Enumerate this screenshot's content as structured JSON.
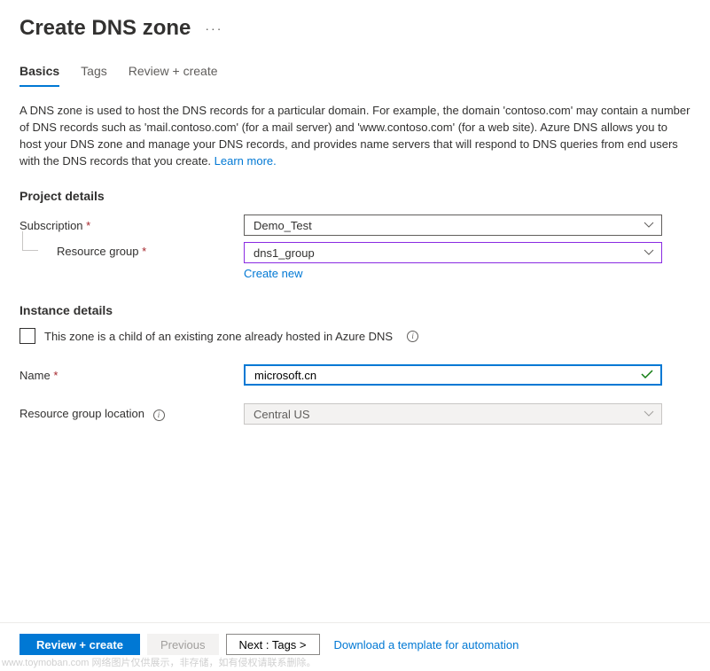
{
  "header": {
    "title": "Create DNS zone",
    "more": "···"
  },
  "tabs": {
    "basics": "Basics",
    "tags": "Tags",
    "review": "Review + create"
  },
  "description": {
    "text": "A DNS zone is used to host the DNS records for a particular domain. For example, the domain 'contoso.com' may contain a number of DNS records such as 'mail.contoso.com' (for a mail server) and 'www.contoso.com' (for a web site). Azure DNS allows you to host your DNS zone and manage your DNS records, and provides name servers that will respond to DNS queries from end users with the DNS records that you create.  ",
    "learn_more": "Learn more."
  },
  "project_details": {
    "title": "Project details",
    "subscription": {
      "label": "Subscription",
      "value": "Demo_Test"
    },
    "resource_group": {
      "label": "Resource group",
      "value": "dns1_group",
      "create_new": "Create new"
    }
  },
  "instance_details": {
    "title": "Instance details",
    "child_zone": {
      "label": "This zone is a child of an existing zone already hosted in Azure DNS"
    },
    "name": {
      "label": "Name",
      "value": "microsoft.cn"
    },
    "location": {
      "label": "Resource group location",
      "value": "Central US"
    }
  },
  "footer": {
    "review": "Review + create",
    "previous": "Previous",
    "next": "Next : Tags >",
    "download": "Download a template for automation"
  },
  "watermark": "www.toymoban.com 网络图片仅供展示，非存储，如有侵权请联系删除。"
}
